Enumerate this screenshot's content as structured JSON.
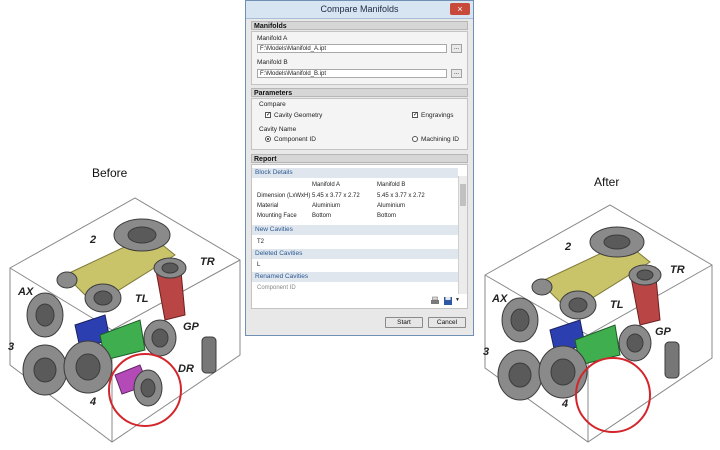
{
  "captions": {
    "before": "Before",
    "after": "After"
  },
  "before_model": {
    "ports": [
      "2",
      "TR",
      "AX",
      "TL",
      "3",
      "GP",
      "DR",
      "4"
    ]
  },
  "after_model": {
    "ports": [
      "2",
      "TR",
      "AX",
      "TL",
      "3",
      "GP",
      "4"
    ]
  },
  "dialog": {
    "title": "Compare Manifolds",
    "close_label": "×",
    "manifolds": {
      "header": "Manifolds",
      "a_label": "Manifold A",
      "a_path": "F:\\Models\\Manifold_A.ipt",
      "b_label": "Manifold B",
      "b_path": "F:\\Models\\Manifold_B.ipt",
      "browse": "..."
    },
    "parameters": {
      "header": "Parameters",
      "compare_label": "Compare",
      "cavity_geometry": "Cavity Geometry",
      "engravings": "Engravings",
      "cavity_name_label": "Cavity Name",
      "component_id": "Component ID",
      "machining_id": "Machining ID"
    },
    "report": {
      "header": "Report",
      "block_details": "Block Details",
      "col_a": "Manifold A",
      "col_b": "Manifold B",
      "rows": [
        {
          "label": "Dimension (LxWxH)",
          "a": "5.45 x 3.77 x 2.72",
          "b": "5.45 x 3.77 x 2.72"
        },
        {
          "label": "Material",
          "a": "Aluminium",
          "b": "Aluminium"
        },
        {
          "label": "Mounting Face",
          "a": "Bottom",
          "b": "Bottom"
        }
      ],
      "new_cavities": "New Cavities",
      "new_item": "T2",
      "deleted_cavities": "Deleted Cavities",
      "deleted_item": "L",
      "renamed_cavities": "Renamed Cavities",
      "renamed_item": "Component ID"
    },
    "start": "Start",
    "cancel": "Cancel"
  },
  "colors": {
    "highlight_circle": "#d3262c",
    "titlebar": "#d7e4f2",
    "link_blue": "#2c5a92"
  }
}
